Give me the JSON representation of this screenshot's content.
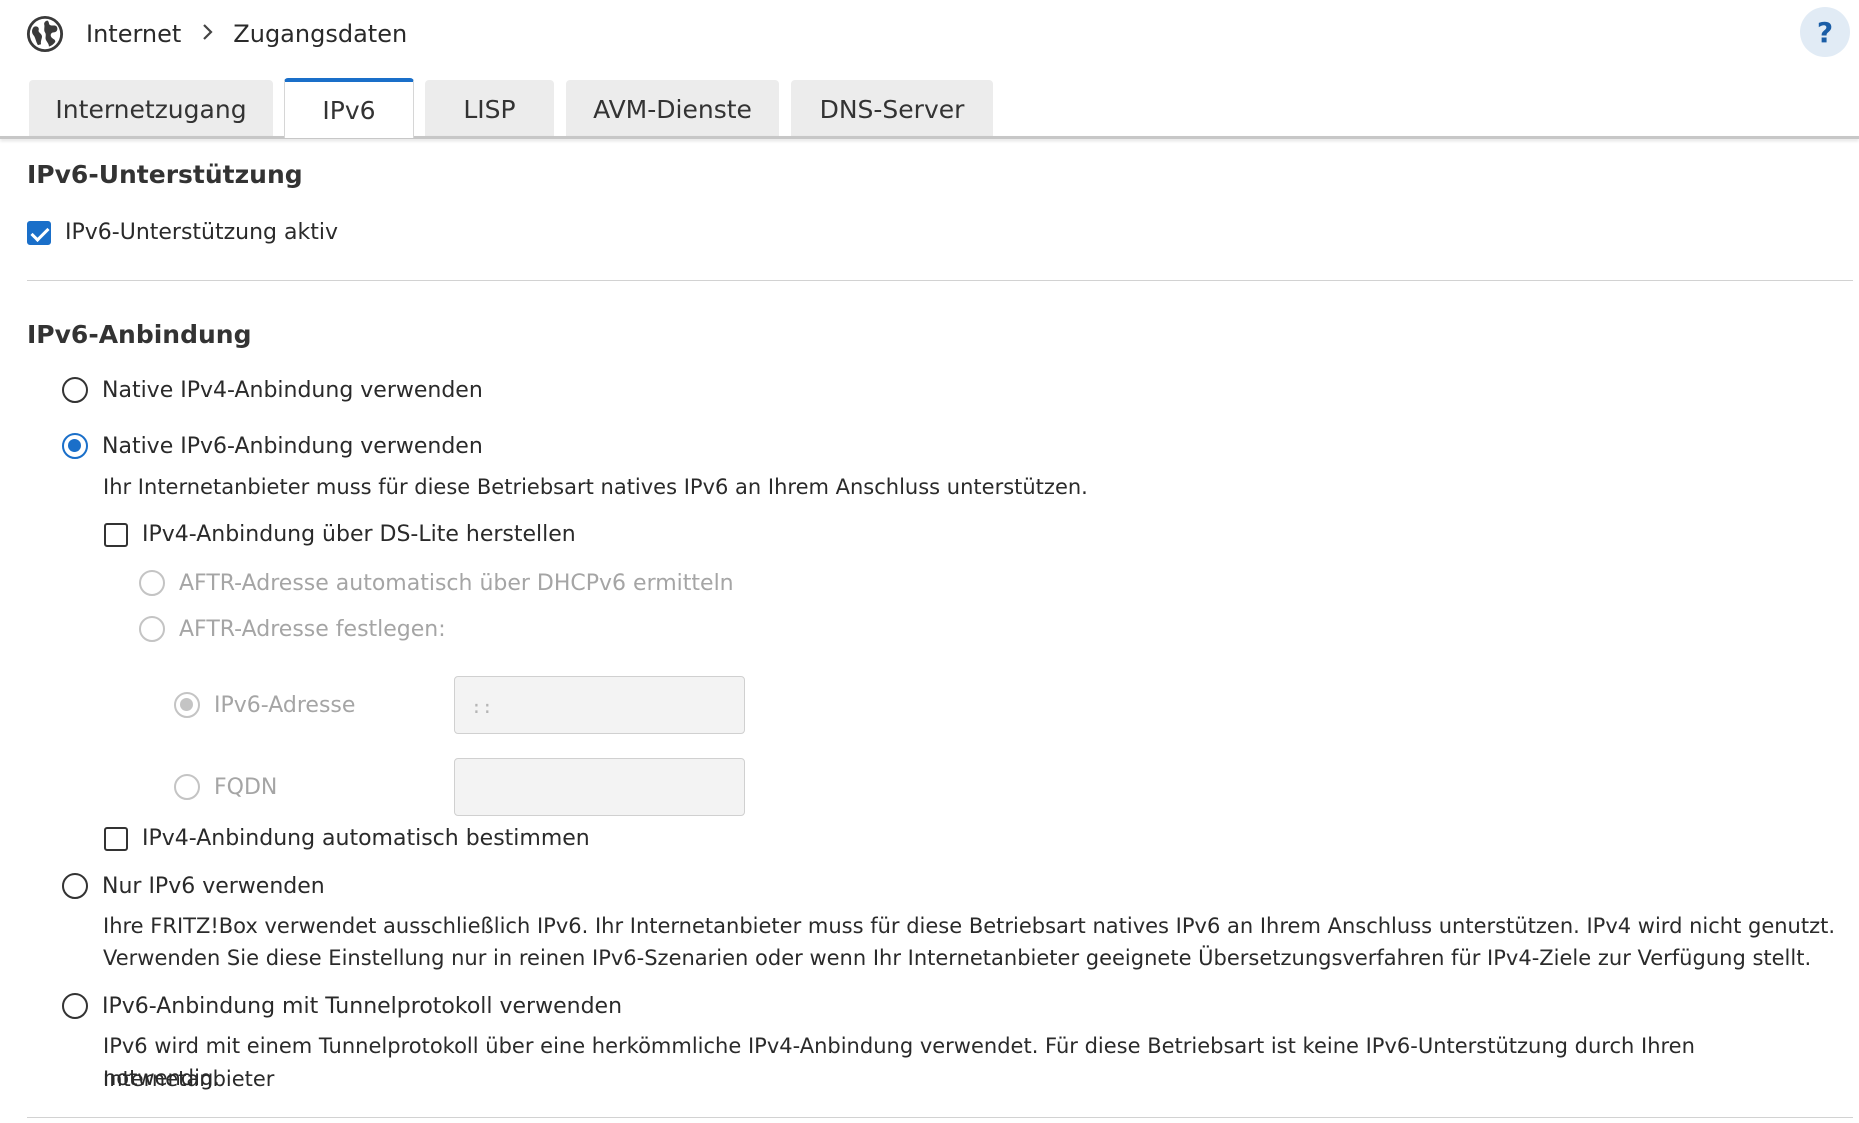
{
  "header": {
    "globe_icon": "globe-icon",
    "breadcrumb": [
      "Internet",
      "Zugangsdaten"
    ],
    "help_label": "?"
  },
  "tabs": [
    {
      "label": "Internetzugang",
      "active": false
    },
    {
      "label": "IPv6",
      "active": true
    },
    {
      "label": "LISP",
      "active": false
    },
    {
      "label": "AVM-Dienste",
      "active": false
    },
    {
      "label": "DNS-Server",
      "active": false
    }
  ],
  "support": {
    "title": "IPv6-Unterstützung",
    "checkbox_label": "IPv6-Unterstützung aktiv",
    "checked": true
  },
  "connection": {
    "title": "IPv6-Anbindung",
    "native_ipv4": "Native IPv4-Anbindung verwenden",
    "native_ipv6": "Native IPv6-Anbindung verwenden",
    "native_ipv6_selected": true,
    "native_ipv6_help": "Ihr Internetanbieter muss für diese Betriebsart natives IPv6 an Ihrem Anschluss unterstützen.",
    "dslite_label": "IPv4-Anbindung über DS-Lite herstellen",
    "aftr_auto": "AFTR-Adresse automatisch über DHCPv6 ermitteln",
    "aftr_set": "AFTR-Adresse festlegen:",
    "ipv6_address_label": "IPv6-Adresse",
    "ipv6_address_value": "::",
    "fqdn_label": "FQDN",
    "fqdn_value": "",
    "ipv4_auto_label": "IPv4-Anbindung automatisch bestimmen",
    "only_ipv6": "Nur IPv6 verwenden",
    "only_ipv6_help_1": "Ihre FRITZ!Box verwendet ausschließlich IPv6. Ihr Internetanbieter muss für diese Betriebsart natives IPv6 an Ihrem Anschluss unterstützen. IPv4 wird nicht genutzt.",
    "only_ipv6_help_2": "Verwenden Sie diese Einstellung nur in reinen IPv6-Szenarien oder wenn Ihr Internetanbieter geeignete Übersetzungsverfahren für IPv4-Ziele zur Verfügung stellt.",
    "tunnel": "IPv6-Anbindung mit Tunnelprotokoll verwenden",
    "tunnel_help_1": "IPv6 wird mit einem Tunnelprotokoll über eine herkömmliche IPv4-Anbindung verwendet. Für diese Betriebsart ist keine IPv6-Unterstützung durch Ihren Internetanbieter",
    "tunnel_help_2": "notwendig."
  },
  "colors": {
    "accent": "#1a6fc9",
    "disabled_text": "#a5a5a5",
    "tab_inactive": "#ececec",
    "help_bg": "#e1ebf5"
  }
}
